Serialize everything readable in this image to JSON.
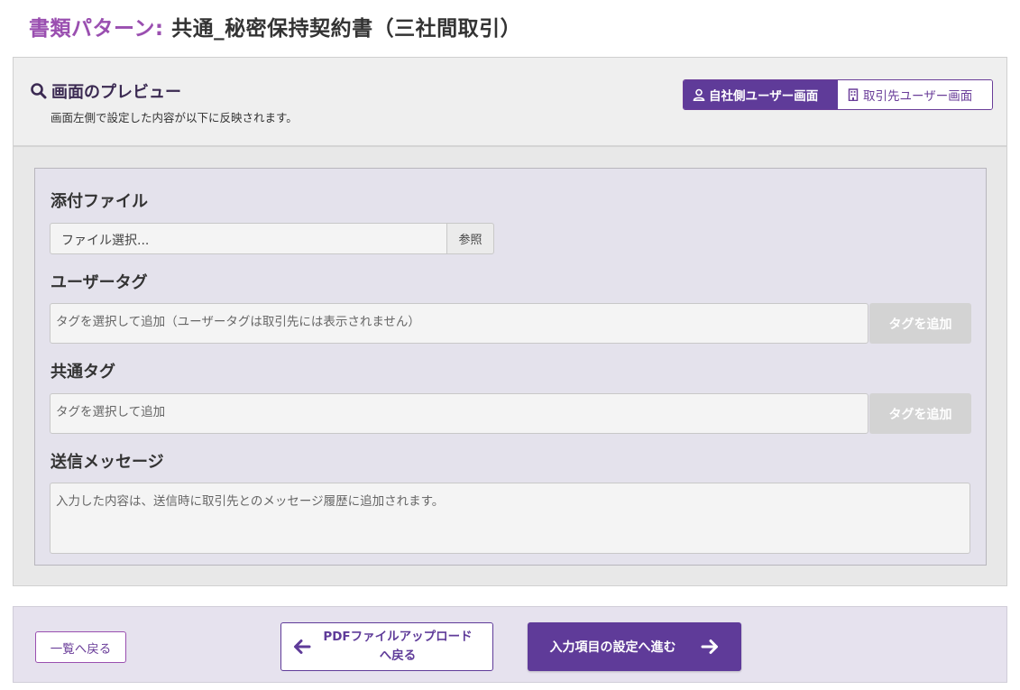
{
  "header": {
    "title_prefix": "書類パターン:",
    "title_main": " 共通_秘密保持契約書（三社間取引）"
  },
  "preview": {
    "title": "画面のプレビュー",
    "subtitle": "画面左側で設定した内容が以下に反映されます。",
    "toggle": {
      "own_label": "自社側ユーザー画面",
      "partner_label": "取引先ユーザー画面",
      "selected": "own"
    }
  },
  "form": {
    "attachment": {
      "label": "添付ファイル",
      "placeholder": "ファイル選択...",
      "browse_label": "参照"
    },
    "user_tags": {
      "label": "ユーザータグ",
      "placeholder": "タグを選択して追加（ユーザータグは取引先には表示されません）",
      "add_label": "タグを追加"
    },
    "common_tags": {
      "label": "共通タグ",
      "placeholder": "タグを選択して追加",
      "add_label": "タグを追加"
    },
    "message": {
      "label": "送信メッセージ",
      "placeholder": "入力した内容は、送信時に取引先とのメッセージ履歴に追加されます。"
    }
  },
  "footer": {
    "back_list_label": "一覧へ戻る",
    "back_pdf_line1": "PDFファイルアップロード",
    "back_pdf_line2": "へ戻る",
    "next_label": "入力項目の設定へ進む"
  },
  "colors": {
    "accent": "#5f3b99",
    "title_prefix": "#9a4fb0",
    "disabled_button": "#d3d3d3"
  },
  "icons": {
    "preview": "search-icon",
    "own_screen": "user-icon",
    "partner_screen": "building-icon",
    "back": "arrow-left-icon",
    "next": "arrow-right-icon"
  }
}
